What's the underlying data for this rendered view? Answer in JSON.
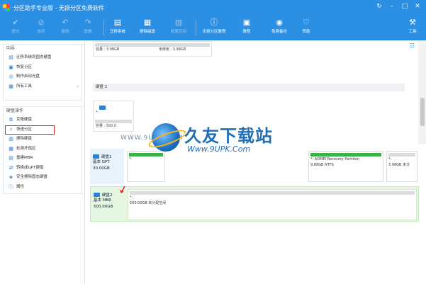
{
  "window": {
    "title": "分区助手专业版 - 无损分区免费软件",
    "controls": [
      "↻",
      "–",
      "□",
      "✕"
    ]
  },
  "toolbar": {
    "items": [
      {
        "label": "提交",
        "icon": "✔",
        "enabled": false
      },
      {
        "label": "放弃",
        "icon": "⊘",
        "enabled": false
      },
      {
        "label": "撤销",
        "icon": "↶",
        "enabled": false
      },
      {
        "label": "重做",
        "icon": "↷",
        "enabled": false
      },
      {
        "label": "迁移系统",
        "icon": "▤",
        "enabled": true
      },
      {
        "label": "擦除磁盘",
        "icon": "▦",
        "enabled": true
      },
      {
        "label": "配置空间",
        "icon": "▥",
        "enabled": false
      },
      {
        "label": "无损分区教程",
        "icon": "ⓘ",
        "enabled": true
      },
      {
        "label": "教程",
        "icon": "▣",
        "enabled": true
      },
      {
        "label": "免费备份",
        "icon": "◉",
        "enabled": true
      },
      {
        "label": "赞助",
        "icon": "♡",
        "enabled": true
      },
      {
        "label": "工具",
        "icon": "⚒",
        "enabled": true
      }
    ]
  },
  "sidebar": {
    "guide_title": "向导",
    "guide_items": [
      {
        "label": "迁移系统到固态硬盘",
        "icon": "▤"
      },
      {
        "label": "恢复分区",
        "icon": "▣"
      },
      {
        "label": "制作启动光盘",
        "icon": "◎"
      },
      {
        "label": "所有工具",
        "icon": "▦",
        "chevron": "›"
      }
    ],
    "disk_ops_title": "硬盘操作",
    "disk_items": [
      {
        "label": "克隆硬盘",
        "icon": "⧉"
      },
      {
        "label": "快速分区",
        "icon": "⚡"
      },
      {
        "label": "擦除硬盘",
        "icon": "▥"
      },
      {
        "label": "检测坏扇区",
        "icon": "▦"
      },
      {
        "label": "重建MBR",
        "icon": "▤"
      },
      {
        "label": "转换成GPT硬盘",
        "icon": "⇄"
      },
      {
        "label": "安全擦除固态硬盘",
        "icon": "◈"
      },
      {
        "label": "属性",
        "icon": "ⓘ"
      }
    ]
  },
  "main": {
    "top_card": {
      "used": "容量 : 3.98GB",
      "unused": "未使用 : 3.98GB"
    },
    "disk2_header": "硬盘 2",
    "disk2_card": {
      "name": "*:",
      "cap": "容量 : 500.0"
    },
    "disk1": {
      "name": "硬盘1",
      "type": "基本 GPT",
      "size": "30.00GB",
      "partitions": [
        {
          "name": "*:",
          "size": "",
          "color": "#3db24b"
        },
        {
          "name": "*: AOMEI Recovery Partition",
          "size": "9.88GB NTFS",
          "color": "#3db24b"
        },
        {
          "name": "*:",
          "size": "3.98GB 未分",
          "color": "#dcdcdc"
        }
      ]
    },
    "disk2": {
      "name": "硬盘2",
      "type": "基本 MBR",
      "size": "500.00GB",
      "partition": {
        "name": "*:",
        "size": "500.00GB 未分配空间"
      }
    },
    "watermark": {
      "brand": "久友下载站",
      "url": "Www.9UPK.Com",
      "url2": "WWW.9UPK.COM"
    }
  }
}
